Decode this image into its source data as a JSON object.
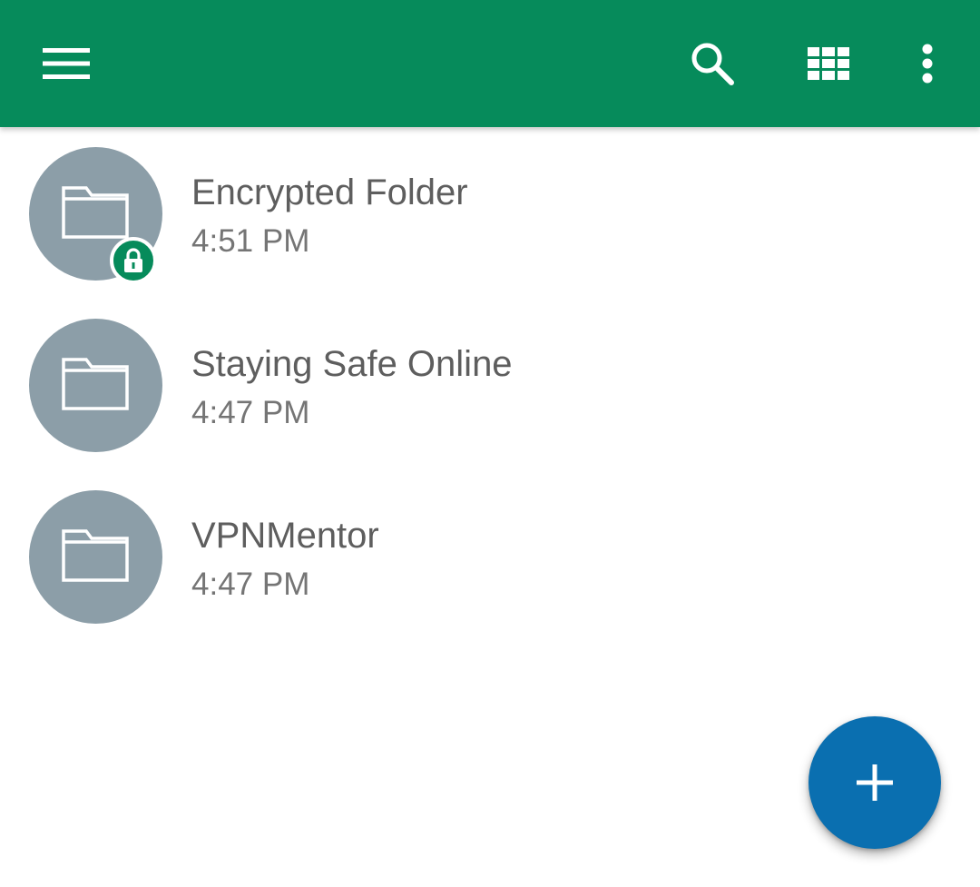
{
  "appbar": {
    "background_color": "#068b5b",
    "icons": {
      "menu": "hamburger-menu-icon",
      "search": "search-icon",
      "grid": "grid-view-icon",
      "more": "more-vertical-icon"
    }
  },
  "folders": [
    {
      "name": "Encrypted Folder",
      "time": "4:51 PM",
      "icon": "folder-icon",
      "encrypted": true,
      "badge_icon": "lock-icon"
    },
    {
      "name": "Staying Safe Online",
      "time": "4:47 PM",
      "icon": "folder-icon",
      "encrypted": false
    },
    {
      "name": "VPNMentor",
      "time": "4:47 PM",
      "icon": "folder-icon",
      "encrypted": false
    }
  ],
  "fab": {
    "icon": "plus-icon",
    "color": "#0a6fb0"
  },
  "colors": {
    "avatar": "#8c9ea8",
    "title_text": "#5e5e5e",
    "time_text": "#757575"
  }
}
